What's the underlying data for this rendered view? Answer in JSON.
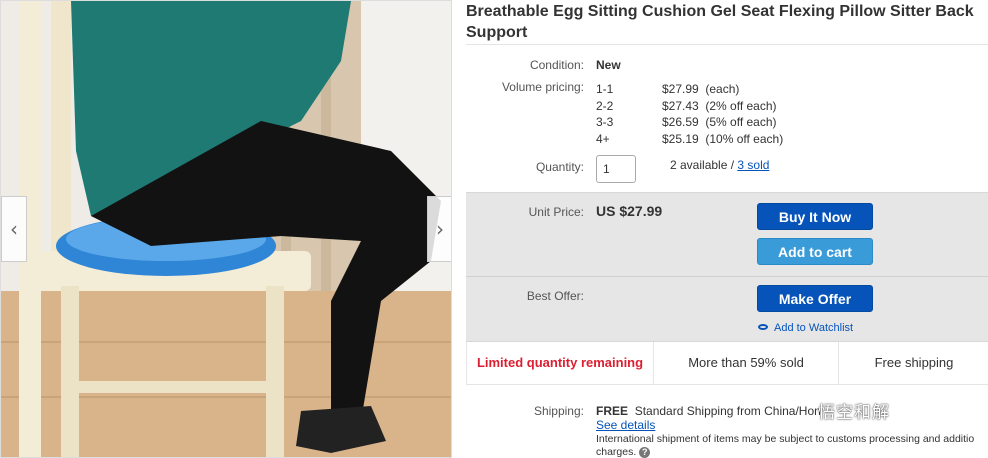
{
  "gallery": {
    "prev_arrow": "‹",
    "next_arrow": "›"
  },
  "listing": {
    "title": "Breathable Egg Sitting Cushion Gel Seat Flexing Pillow Sitter Back Support",
    "condition_label": "Condition:",
    "condition_value": "New",
    "volume_label": "Volume pricing:",
    "volume_pricing": [
      {
        "qty": "1-1",
        "price": "$27.99",
        "note": "(each)"
      },
      {
        "qty": "2-2",
        "price": "$27.43",
        "note": "(2% off each)"
      },
      {
        "qty": "3-3",
        "price": "$26.59",
        "note": "(5% off each)"
      },
      {
        "qty": "4+",
        "price": "$25.19",
        "note": "(10% off each)"
      }
    ],
    "quantity_label": "Quantity:",
    "quantity_value": "1",
    "available_text": "2 available /",
    "sold_link": "3 sold"
  },
  "buy_box": {
    "unit_price_label": "Unit Price:",
    "unit_price_value": "US $27.99",
    "buy_now_label": "Buy It Now",
    "add_to_cart_label": "Add to cart",
    "best_offer_label": "Best Offer:",
    "make_offer_label": "Make Offer",
    "watchlist_label": "Add to Watchlist"
  },
  "badges": {
    "limited": "Limited quantity remaining",
    "sold_pct": "More than 59% sold",
    "free_shipping": "Free shipping"
  },
  "shipping": {
    "label": "Shipping:",
    "free": "FREE",
    "method": "Standard Shipping from China/Hon",
    "see_details": "See details",
    "note": "International shipment of items may be subject to customs processing and additio",
    "note2": "charges.",
    "help_icon": "?"
  },
  "watermark": {
    "text": "悟空和解"
  },
  "colors": {
    "primary_button": "#0654ba",
    "cart_button": "#3a9bd9",
    "alert_text": "#dd1e31",
    "link": "#0654ba"
  }
}
